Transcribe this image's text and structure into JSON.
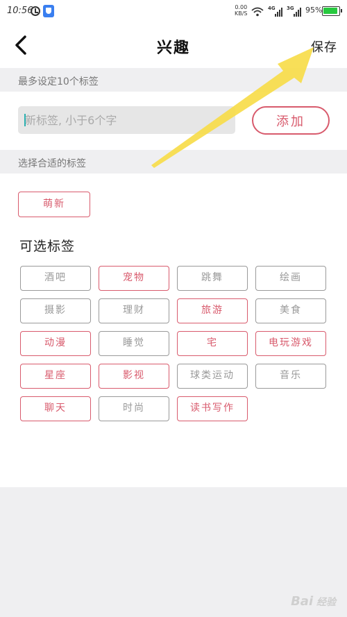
{
  "status_bar": {
    "time": "10:56",
    "net_speed_value": "0.00",
    "net_speed_unit": "KB/S",
    "sim1_label": "4G",
    "sim2_label": "3G",
    "battery": "95%",
    "battery_level": 0.95,
    "battery_color": "#27c93f",
    "icons": [
      "alarm-icon",
      "shield-icon",
      "wifi-icon",
      "signal-icon",
      "battery-icon"
    ]
  },
  "nav": {
    "title": "兴趣",
    "save_label": "保存",
    "back_icon": "chevron-left-icon"
  },
  "limit_header": "最多设定10个标签",
  "input": {
    "placeholder": "新标签, 小于6个字",
    "value": ""
  },
  "add_label": "添加",
  "suitable_header": "选择合适的标签",
  "selected_tags": [
    "萌新"
  ],
  "optional_title": "可选标签",
  "optional_tags": [
    {
      "label": "酒吧",
      "selected": false
    },
    {
      "label": "宠物",
      "selected": true
    },
    {
      "label": "跳舞",
      "selected": false
    },
    {
      "label": "绘画",
      "selected": false
    },
    {
      "label": "摄影",
      "selected": false
    },
    {
      "label": "理财",
      "selected": false
    },
    {
      "label": "旅游",
      "selected": true
    },
    {
      "label": "美食",
      "selected": false
    },
    {
      "label": "动漫",
      "selected": true
    },
    {
      "label": "睡觉",
      "selected": false
    },
    {
      "label": "宅",
      "selected": true
    },
    {
      "label": "电玩游戏",
      "selected": true
    },
    {
      "label": "星座",
      "selected": true
    },
    {
      "label": "影视",
      "selected": true
    },
    {
      "label": "球类运动",
      "selected": false
    },
    {
      "label": "音乐",
      "selected": false
    },
    {
      "label": "聊天",
      "selected": true
    },
    {
      "label": "时尚",
      "selected": false
    },
    {
      "label": "读书写作",
      "selected": true
    }
  ],
  "colors": {
    "accent": "#d85a6c",
    "unselected": "#999999",
    "section_bg": "#efeff1",
    "arrow": "#f7dc4a"
  },
  "watermark": "Bai 经验"
}
